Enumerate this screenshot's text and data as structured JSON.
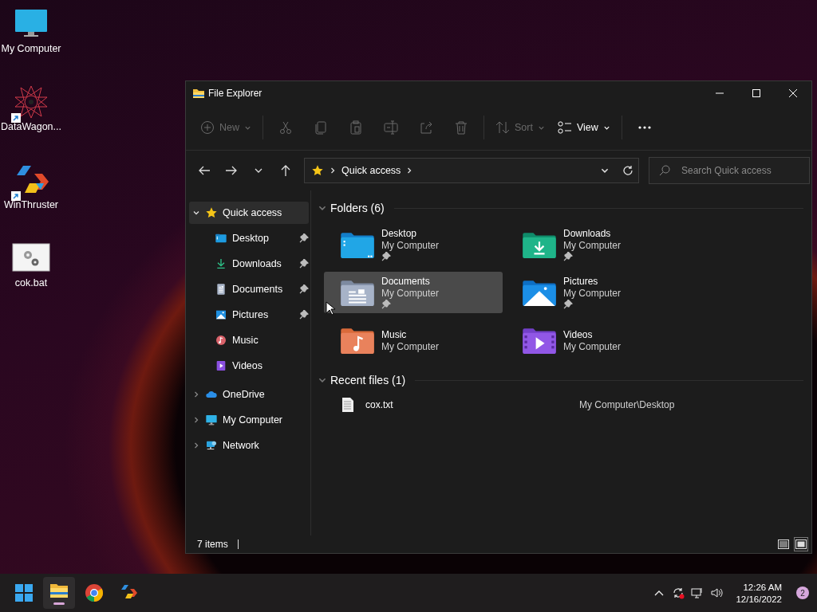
{
  "desktop_icons": [
    {
      "label": "My Computer",
      "kind": "monitor",
      "shortcut": false
    },
    {
      "label": "DataWagon...",
      "kind": "mandala",
      "shortcut": true
    },
    {
      "label": "WinThruster",
      "kind": "thruster",
      "shortcut": true
    },
    {
      "label": "cok.bat",
      "kind": "batch",
      "shortcut": false
    }
  ],
  "window": {
    "title": "File Explorer",
    "toolbar": [
      {
        "kind": "new",
        "label": "New",
        "disabled": true
      },
      {
        "kind": "cut",
        "disabled": true
      },
      {
        "kind": "copy",
        "disabled": true
      },
      {
        "kind": "paste",
        "disabled": true
      },
      {
        "kind": "rename",
        "disabled": true
      },
      {
        "kind": "share",
        "disabled": true
      },
      {
        "kind": "delete",
        "disabled": true
      },
      {
        "kind": "sort",
        "label": "Sort",
        "disabled": true
      },
      {
        "kind": "view",
        "label": "View",
        "disabled": false
      },
      {
        "kind": "more",
        "disabled": false
      }
    ],
    "address": {
      "path": "Quick access"
    },
    "search": {
      "placeholder": "Search Quick access"
    },
    "sidebar": {
      "items": [
        {
          "label": "Quick access",
          "kind": "star",
          "selected": true,
          "expanded": true,
          "children": [
            {
              "label": "Desktop",
              "kind": "desktop",
              "pinned": true,
              "selected": false
            },
            {
              "label": "Downloads",
              "kind": "downloads",
              "pinned": true,
              "selected": false
            },
            {
              "label": "Documents",
              "kind": "documents",
              "pinned": true,
              "selected": false
            },
            {
              "label": "Pictures",
              "kind": "pictures",
              "pinned": true,
              "selected": false
            },
            {
              "label": "Music",
              "kind": "music",
              "pinned": false,
              "selected": false
            },
            {
              "label": "Videos",
              "kind": "videos",
              "pinned": false,
              "selected": false
            }
          ]
        },
        {
          "label": "OneDrive",
          "kind": "onedrive",
          "selected": false,
          "expanded": false
        },
        {
          "label": "My Computer",
          "kind": "monitor",
          "selected": false,
          "expanded": false
        },
        {
          "label": "Network",
          "kind": "network",
          "selected": false,
          "expanded": false
        }
      ]
    },
    "folders": {
      "heading": "Folders (6)",
      "items": [
        {
          "name": "Desktop",
          "location": "My Computer",
          "kind": "desktop",
          "pinned": true,
          "selected": false
        },
        {
          "name": "Downloads",
          "location": "My Computer",
          "kind": "downloads",
          "pinned": true,
          "selected": false
        },
        {
          "name": "Documents",
          "location": "My Computer",
          "kind": "documents",
          "pinned": true,
          "selected": true
        },
        {
          "name": "Pictures",
          "location": "My Computer",
          "kind": "pictures",
          "pinned": true,
          "selected": false
        },
        {
          "name": "Music",
          "location": "My Computer",
          "kind": "music",
          "pinned": false,
          "selected": false
        },
        {
          "name": "Videos",
          "location": "My Computer",
          "kind": "videos",
          "pinned": false,
          "selected": false
        }
      ]
    },
    "recent": {
      "heading": "Recent files (1)",
      "files": [
        {
          "name": "cox.txt",
          "path": "My Computer\\Desktop"
        }
      ]
    },
    "status_bar": {
      "count": "7 items",
      "views": [
        {
          "kind": "details",
          "selected": false
        },
        {
          "kind": "tiles",
          "selected": true
        }
      ]
    }
  },
  "taskbar": {
    "apps": [
      {
        "kind": "start",
        "active": false
      },
      {
        "kind": "explorer",
        "active": true
      },
      {
        "kind": "browser",
        "active": false
      },
      {
        "kind": "thruster",
        "active": false
      }
    ],
    "tray": [
      {
        "kind": "chevron"
      },
      {
        "kind": "sync"
      },
      {
        "kind": "network"
      },
      {
        "kind": "volume"
      }
    ],
    "time": "12:26 AM",
    "date": "12/16/2022",
    "notifications": "2"
  }
}
